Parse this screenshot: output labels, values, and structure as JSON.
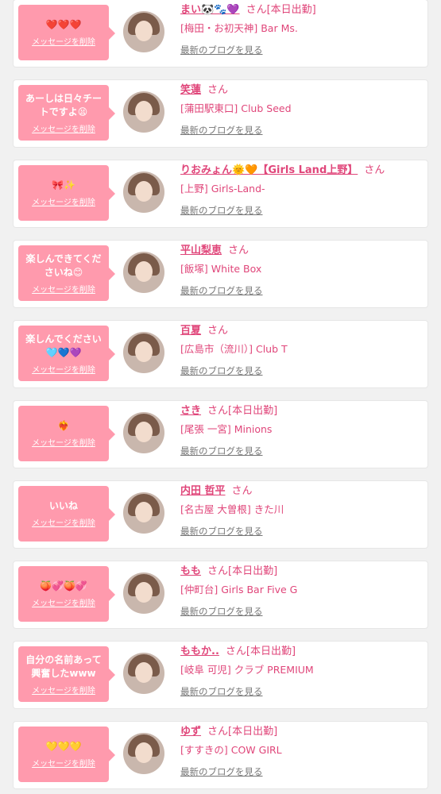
{
  "delete_label": "メッセージを削除",
  "blog_label": "最新のブログを見る",
  "san_label": "さん",
  "work_label": "[本日出勤]",
  "cards": [
    {
      "message": "❤️❤️❤️",
      "name": "まい🐼🐾💜",
      "working": true,
      "shop": "[梅田・お初天神] Bar Ms."
    },
    {
      "message": "あーしは日々チートですよ😫",
      "name": "笑蓮",
      "working": false,
      "shop": "[蒲田駅東口] Club Seed"
    },
    {
      "message": "🎀✨",
      "name": "りおみょん🌞🧡【Girls Land上野】",
      "working": false,
      "shop": "[上野] Girls-Land-"
    },
    {
      "message": "楽しんできてくださいね😊",
      "name": "平山梨恵",
      "working": false,
      "shop": "[飯塚] White Box"
    },
    {
      "message": "楽しんでください🩵💙💜",
      "name": "百夏",
      "working": false,
      "shop": "[広島市（流川）] Club T"
    },
    {
      "message": "❤️‍🔥",
      "name": "さき",
      "working": true,
      "shop": "[尾張 一宮] Minions"
    },
    {
      "message": "いいね",
      "name": "内田 哲平",
      "working": false,
      "shop": "[名古屋 大曽根] きた川"
    },
    {
      "message": "🍑💞🍑💞",
      "name": "もも",
      "working": true,
      "shop": "[仲町台] Girls Bar Five G"
    },
    {
      "message": "自分の名前あって興奮したwww",
      "name": "ももか..",
      "working": true,
      "shop": "[岐阜 可児] クラブ PREMIUM"
    },
    {
      "message": "💛💛💛",
      "name": "ゆず",
      "working": true,
      "shop": "[すすきの] COW GIRL"
    }
  ]
}
